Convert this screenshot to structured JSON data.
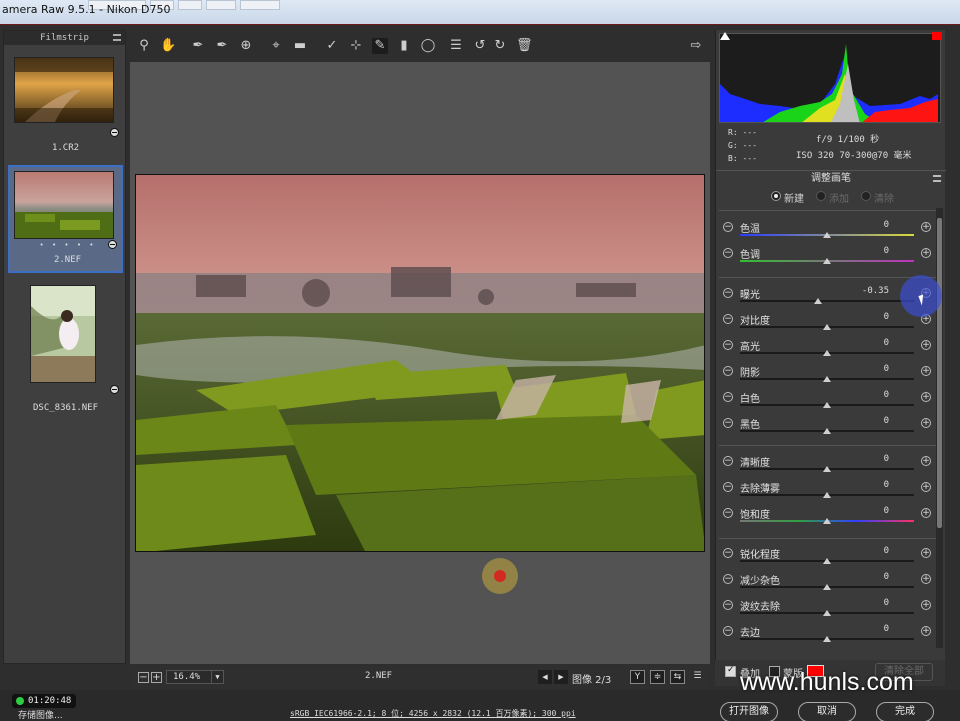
{
  "window": {
    "title": "amera Raw 9.5.1 -  Nikon D750"
  },
  "filmstrip": {
    "title": "Filmstrip",
    "items": [
      {
        "name": "1.CR2",
        "dots": ""
      },
      {
        "name": "2.NEF",
        "dots": "• • • • •"
      },
      {
        "name": "DSC_8361.NEF",
        "dots": ""
      }
    ]
  },
  "toolbar": {
    "tools": [
      "zoom-tool",
      "hand-tool",
      "white-balance-tool",
      "color-sampler-tool",
      "targeted-adjustment-tool",
      "crop-tool",
      "straighten-tool",
      "spot-removal-tool",
      "red-eye-tool",
      "adjustment-brush-tool",
      "graduated-filter-tool",
      "radial-filter-tool",
      "preferences",
      "rotate-left",
      "rotate-right",
      "trash"
    ]
  },
  "histogram": {
    "readout": {
      "r": "R:  ---",
      "g": "G:  ---",
      "b": "B:  ---"
    },
    "aperture_shutter": "f/9   1/100 秒",
    "iso_lens": "ISO 320   70-300@70 毫米"
  },
  "panel": {
    "title": "调整画笔",
    "modes": [
      {
        "label": "新建",
        "state": "on"
      },
      {
        "label": "添加",
        "state": "off"
      },
      {
        "label": "清除",
        "state": "off"
      }
    ],
    "sliders": [
      {
        "label": "色温",
        "value": "0",
        "pos": 0.5,
        "track": "temp"
      },
      {
        "label": "色调",
        "value": "0",
        "pos": 0.5,
        "track": "tint"
      },
      {
        "label": "曝光",
        "value": "-0.35",
        "pos": 0.45,
        "track": "plain"
      },
      {
        "label": "对比度",
        "value": "0",
        "pos": 0.5,
        "track": "plain"
      },
      {
        "label": "高光",
        "value": "0",
        "pos": 0.5,
        "track": "plain"
      },
      {
        "label": "阴影",
        "value": "0",
        "pos": 0.5,
        "track": "plain"
      },
      {
        "label": "白色",
        "value": "0",
        "pos": 0.5,
        "track": "plain"
      },
      {
        "label": "黑色",
        "value": "0",
        "pos": 0.5,
        "track": "plain"
      },
      {
        "label": "清晰度",
        "value": "0",
        "pos": 0.5,
        "track": "plain"
      },
      {
        "label": "去除薄雾",
        "value": "0",
        "pos": 0.5,
        "track": "plain"
      },
      {
        "label": "饱和度",
        "value": "0",
        "pos": 0.5,
        "track": "sat"
      },
      {
        "label": "锐化程度",
        "value": "0",
        "pos": 0.5,
        "track": "plain"
      },
      {
        "label": "减少杂色",
        "value": "0",
        "pos": 0.5,
        "track": "plain"
      },
      {
        "label": "波纹去除",
        "value": "0",
        "pos": 0.5,
        "track": "plain"
      },
      {
        "label": "去边",
        "value": "0",
        "pos": 0.5,
        "track": "plain"
      }
    ],
    "overlay_label": "叠加",
    "mask_label": "蒙版",
    "mask_color": "#ff0000",
    "clear_all": "清除全部"
  },
  "status": {
    "zoom": "16.4%",
    "filename": "2.NEF",
    "pager": "图像 2/3",
    "view_buttons": [
      "Y",
      "≑",
      "⇆",
      "☰"
    ]
  },
  "footer": {
    "timer": "01:20:48",
    "save": "存储图像...",
    "workflow": "sRGB IEC61966-2.1; 8 位; 4256 x 2832 (12.1 百万像素); 300 ppi",
    "open": "打开图像",
    "cancel": "取消",
    "done": "完成"
  },
  "watermark": "www.hunls.com",
  "colors": {
    "accent": "#3d6fc7",
    "mask": "#ff0000",
    "timer_led": "#2ecc40"
  }
}
